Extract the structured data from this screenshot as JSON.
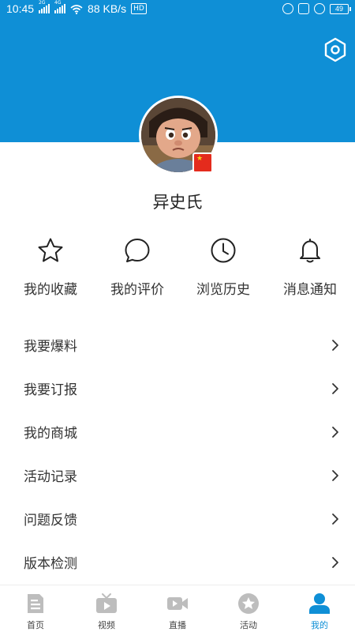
{
  "statusbar": {
    "time": "10:45",
    "sig1_tag": "2G",
    "sig2_tag": "4G",
    "speed": "88 KB/s",
    "hd": "HD",
    "battery": "49"
  },
  "colors": {
    "primary": "#0f8fd6",
    "flag_red": "#e42b1d",
    "flag_star": "#f7d417",
    "icon_gray": "#bdbdbd"
  },
  "header": {
    "settings_icon": "hexagon-gear-icon"
  },
  "profile": {
    "username": "异史氏",
    "avatar": "cartoon-avatar",
    "badge": "china-flag-icon"
  },
  "quick_actions": [
    {
      "label": "我的收藏",
      "icon": "star-icon"
    },
    {
      "label": "我的评价",
      "icon": "comment-icon"
    },
    {
      "label": "浏览历史",
      "icon": "clock-icon"
    },
    {
      "label": "消息通知",
      "icon": "bell-icon"
    }
  ],
  "menu": [
    {
      "label": "我要爆料"
    },
    {
      "label": "我要订报"
    },
    {
      "label": "我的商城"
    },
    {
      "label": "活动记录"
    },
    {
      "label": "问题反馈"
    },
    {
      "label": "版本检测"
    }
  ],
  "tabs": [
    {
      "label": "首页",
      "icon": "document-icon",
      "active": false
    },
    {
      "label": "视频",
      "icon": "tv-icon",
      "active": false
    },
    {
      "label": "直播",
      "icon": "video-camera-icon",
      "active": false
    },
    {
      "label": "活动",
      "icon": "star-badge-icon",
      "active": false
    },
    {
      "label": "我的",
      "icon": "user-icon",
      "active": true
    }
  ]
}
